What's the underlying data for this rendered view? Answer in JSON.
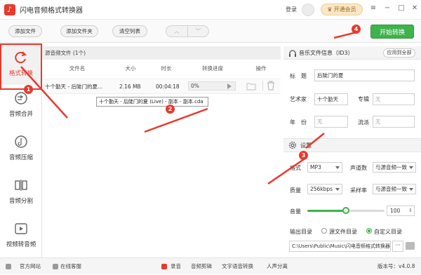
{
  "app": {
    "title": "闪电音频格式转换器"
  },
  "titlebar": {
    "login": "登录",
    "vip": "开通会员"
  },
  "toolbar": {
    "add_file": "添加文件",
    "add_folder": "添加文件夹",
    "clear_list": "清空列表",
    "up": "︿",
    "down": "﹀",
    "start": "开始转换"
  },
  "sidebar": {
    "items": [
      {
        "label": "格式转换",
        "icon": "convert-icon"
      },
      {
        "label": "音频合并",
        "icon": "merge-icon"
      },
      {
        "label": "音频压缩",
        "icon": "compress-icon"
      },
      {
        "label": "音频分割",
        "icon": "split-icon"
      },
      {
        "label": "视频转音频",
        "icon": "video-icon"
      }
    ]
  },
  "filelist": {
    "header": "源音频文件 (1个)",
    "columns": [
      "文件名",
      "大小",
      "时长",
      "转换进度",
      "操作"
    ],
    "rows": [
      {
        "name": "十个勤天 - 后陡门的夏...",
        "size": "2.16 MB",
        "duration": "00:04:18",
        "progress": "0%"
      }
    ],
    "tooltip": "十个勤天 - 后陡门的夏 (Live) - 副本 - 副本.cda"
  },
  "info": {
    "title": "音乐文件信息（ID3）",
    "apply_all": "应用到全部",
    "fields": {
      "title_label": "标　题",
      "title_value": "后陡门的夏",
      "artist_label": "艺术家",
      "artist_value": "十个勤天",
      "album_label": "专辑",
      "album_placeholder": "无",
      "year_label": "年　份",
      "year_placeholder": "无",
      "genre_label": "流派",
      "genre_placeholder": "无"
    }
  },
  "settings": {
    "title": "设置",
    "format_label": "格式",
    "format_value": "MP3",
    "channels_label": "声道数",
    "channels_value": "与源音频一致",
    "quality_label": "质量",
    "quality_value": "256kbps",
    "samplerate_label": "采样率",
    "samplerate_value": "与源音频一致",
    "volume_label": "音量",
    "volume_value": "100",
    "volume_level": 0.5,
    "output_label": "输出目录",
    "opt_source": "源文件目录",
    "opt_custom": "自定义目录",
    "output_path": "C:\\Users\\Public\\Music\\闪电音频格式转换器",
    "dots": "···"
  },
  "statusbar": {
    "website": "官方网站",
    "support": "在线客服",
    "tools": [
      "录音",
      "音频剪辑",
      "文字语音转换",
      "人声分离"
    ],
    "version": "版本号：v4.0.8"
  },
  "annotations": [
    "1",
    "2",
    "3",
    "4"
  ],
  "colors": {
    "accent": "#e8392c",
    "green": "#3fb24c"
  }
}
